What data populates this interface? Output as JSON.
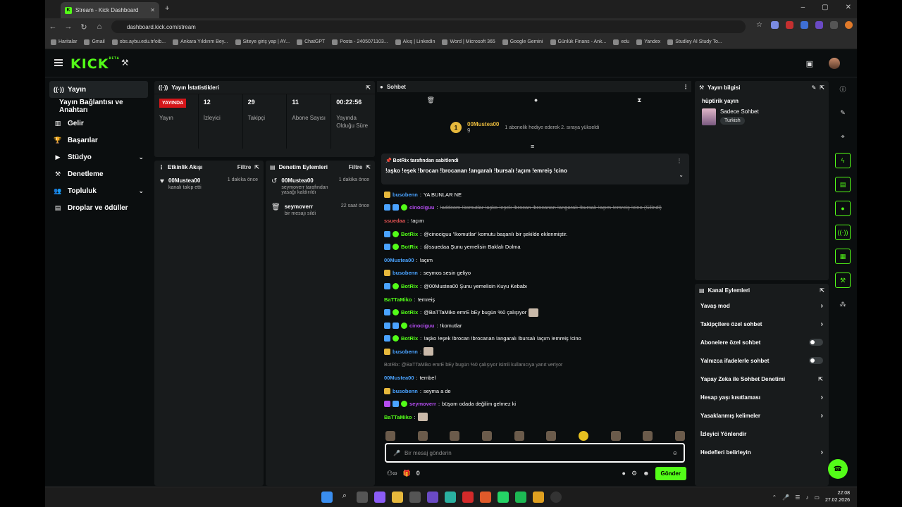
{
  "browser": {
    "tab_title": "Stream - Kick Dashboard",
    "url": "dashboard.kick.com/stream",
    "bookmarks": [
      "Haritalar",
      "Gmail",
      "obs.aybu.edu.tr/oib...",
      "Ankara Yıldırım Bey...",
      "Siteye giriş yap | AY...",
      "ChatGPT",
      "Posta - 2405071103...",
      "Akış | LinkedIn",
      "Word | Microsoft 365",
      "Google Gemini",
      "Günlük Finans - Ank...",
      "edu",
      "Yandex",
      "Studley AI Study To..."
    ]
  },
  "sidebar": {
    "items": [
      "Yayın",
      "Yayın Bağlantısı ve Anahtarı",
      "Gelir",
      "Başarılar",
      "Stüdyo",
      "Denetleme",
      "Topluluk",
      "Droplar ve ödüller"
    ]
  },
  "stats": {
    "title": "Yayın İstatistikleri",
    "live_badge": "YAYINDA",
    "live_label": "Yayın",
    "viewers": "12",
    "viewers_label": "İzleyici",
    "followers": "29",
    "followers_label": "Takipçi",
    "subs": "11",
    "subs_label": "Abone Sayısı",
    "duration": "00:22:56",
    "duration_label": "Yayında Olduğu Süre"
  },
  "activity": {
    "title": "Etkinlik Akışı",
    "filter": "Filtre",
    "user": "00Mustea00",
    "desc": "kanalı takip etti",
    "when": "1 dakika önce"
  },
  "moderation": {
    "title": "Denetim Eylemleri",
    "filter": "Filtre",
    "e1_user": "00Mustea00",
    "e1_when": "1 dakika önce",
    "e1_desc": "seymoverr tarafından yasağı kaldırıldı",
    "e2_user": "seymoverr",
    "e2_when": "22 saat önce",
    "e2_desc": "bir mesajı sildi"
  },
  "chat": {
    "title": "Sohbet",
    "sub_user": "00Mustea00",
    "sub_count": "9",
    "sub_note": "1 abonelik hediye ederek 2. sıraya yükseldi",
    "pin_by": "BotRix tarafından sabitlendi",
    "pin_msg": "!aşko !eşek !brocan !brocanan !angaralı !bursalı !açım !emreiş !cino",
    "messages": [
      {
        "user": "busobenn",
        "text": "YA BUNLAR NE",
        "color": "#4aa3ff",
        "badges": [
          "crown"
        ]
      },
      {
        "user": "cinociguu",
        "text": "!addcom !komutlar !aşko !eşek !brocan !brocanan !angaralı !bursalı !açım !emreiş !cino (Silindi)",
        "color": "#b44df0",
        "badges": [
          "bot",
          "bot",
          "ver"
        ],
        "deleted": true
      },
      {
        "user": "ssuedaa",
        "text": "!açım",
        "color": "#e05252",
        "badges": []
      },
      {
        "user": "BotRix",
        "text": "@cinociguu '!komutlar' komutu başarılı bir şekilde eklenmiştir.",
        "color": "#53fc18",
        "badges": [
          "bot",
          "ver"
        ]
      },
      {
        "user": "BotRix",
        "text": "@ssuedaa Şunu yemelisin Baklalı Dolma",
        "color": "#53fc18",
        "badges": [
          "bot",
          "ver"
        ]
      },
      {
        "user": "00Mustea00",
        "text": "!açım",
        "color": "#4aa3ff",
        "badges": []
      },
      {
        "user": "busobenn",
        "text": "seymos sesin geliyo",
        "color": "#4aa3ff",
        "badges": [
          "crown"
        ]
      },
      {
        "user": "BotRix",
        "text": "@00Mustea00 Şunu yemelisin Kuyu Kebabı",
        "color": "#53fc18",
        "badges": [
          "bot",
          "ver"
        ]
      },
      {
        "user": "BaTTaMiko",
        "text": "!emreiş",
        "color": "#53fc18",
        "badges": []
      },
      {
        "user": "BotRix",
        "text": "@BaTTaMiko emrE bEy bugün %0 çalışıyor",
        "color": "#53fc18",
        "badges": [
          "bot",
          "ver"
        ],
        "emote": true
      },
      {
        "user": "cinociguu",
        "text": "!komutlar",
        "color": "#b44df0",
        "badges": [
          "bot",
          "bot",
          "ver"
        ]
      },
      {
        "user": "BotRix",
        "text": "!aşko !eşek !brocan !brocanan !angaralı !bursalı !açım !emreiş !cino",
        "color": "#53fc18",
        "badges": [
          "bot",
          "ver"
        ]
      },
      {
        "user": "busobenn",
        "text": "",
        "color": "#4aa3ff",
        "badges": [
          "crown"
        ],
        "emote": true
      },
      {
        "user": "00Mustea00",
        "text": "tembel",
        "color": "#4aa3ff",
        "badges": [],
        "reply": "BotRix: @BaTTaMiko emrE bEy bugün %0 çalışıyor  isimli kullanıcıya yanıt veriyor"
      },
      {
        "user": "busobenn",
        "text": "seyma a de",
        "color": "#4aa3ff",
        "badges": [
          "crown"
        ]
      },
      {
        "user": "seymoverr",
        "text": "büşom odada değilim gelmez ki",
        "color": "#b44df0",
        "badges": [
          "mic",
          "bot",
          "ver"
        ]
      },
      {
        "user": "BaTTaMiko",
        "text": "",
        "color": "#53fc18",
        "badges": [],
        "emote": true
      }
    ],
    "input_placeholder": "Bir mesaj gönderin",
    "points": "0",
    "send": "Gönder"
  },
  "info": {
    "title": "Yayın bilgisi",
    "stream_title": "hüptirik yayın",
    "category": "Sadece Sohbet",
    "tag": "Turkish"
  },
  "channel": {
    "title": "Kanal Eylemleri",
    "rows": [
      {
        "label": "Yavaş mod",
        "kind": "arrow"
      },
      {
        "label": "Takipçilere özel sohbet",
        "kind": "arrow"
      },
      {
        "label": "Abonelere özel sohbet",
        "kind": "toggle"
      },
      {
        "label": "Yalnızca ifadelerle sohbet",
        "kind": "toggle"
      },
      {
        "label": "Yapay Zeka ile Sohbet Denetimi",
        "kind": "ext"
      },
      {
        "label": "Hesap yaşı kısıtlaması",
        "kind": "arrow"
      },
      {
        "label": "Yasaklanmış kelimeler",
        "kind": "arrow"
      },
      {
        "label": "İzleyici Yönlendir",
        "kind": "none"
      },
      {
        "label": "Hedefleri belirleyin",
        "kind": "arrow"
      }
    ]
  },
  "taskbar": {
    "time": "22:08",
    "date": "27.02.2026"
  }
}
